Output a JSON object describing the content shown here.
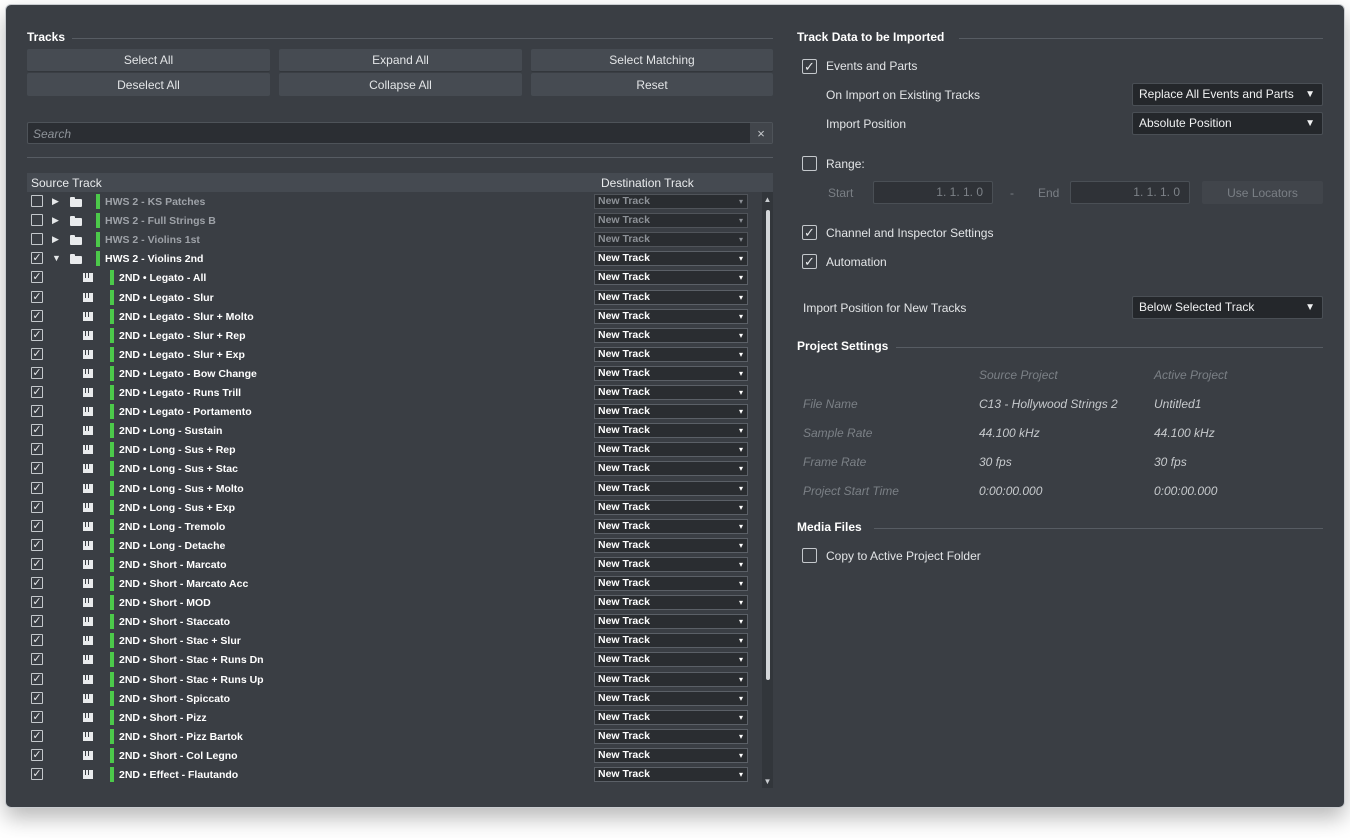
{
  "tracks_panel": {
    "title": "Tracks",
    "buttons": {
      "select_all": "Select All",
      "deselect_all": "Deselect All",
      "expand_all": "Expand All",
      "collapse_all": "Collapse All",
      "select_matching": "Select Matching",
      "reset": "Reset"
    },
    "search_placeholder": "Search",
    "search_clear_icon": "×",
    "columns": {
      "source": "Source Track",
      "destination": "Destination Track"
    },
    "rows": [
      {
        "name": "HWS 2 - KS Patches",
        "dest": "New Track",
        "checked": false,
        "type": "folder",
        "expanded": false,
        "dim": true
      },
      {
        "name": "HWS 2 - Full Strings B",
        "dest": "New Track",
        "checked": false,
        "type": "folder",
        "expanded": false,
        "dim": true
      },
      {
        "name": "HWS 2 - Violins 1st",
        "dest": "New Track",
        "checked": false,
        "type": "folder",
        "expanded": false,
        "dim": true
      },
      {
        "name": "HWS 2 - Violins 2nd",
        "dest": "New Track",
        "checked": true,
        "type": "folder",
        "expanded": true,
        "dim": false
      },
      {
        "name": "2ND • Legato - All",
        "dest": "New Track",
        "checked": true,
        "type": "instrument"
      },
      {
        "name": "2ND • Legato - Slur",
        "dest": "New Track",
        "checked": true,
        "type": "instrument"
      },
      {
        "name": "2ND • Legato - Slur + Molto",
        "dest": "New Track",
        "checked": true,
        "type": "instrument"
      },
      {
        "name": "2ND • Legato - Slur + Rep",
        "dest": "New Track",
        "checked": true,
        "type": "instrument"
      },
      {
        "name": "2ND • Legato - Slur + Exp",
        "dest": "New Track",
        "checked": true,
        "type": "instrument"
      },
      {
        "name": "2ND • Legato - Bow Change",
        "dest": "New Track",
        "checked": true,
        "type": "instrument"
      },
      {
        "name": "2ND • Legato - Runs Trill",
        "dest": "New Track",
        "checked": true,
        "type": "instrument"
      },
      {
        "name": "2ND • Legato - Portamento",
        "dest": "New Track",
        "checked": true,
        "type": "instrument"
      },
      {
        "name": "2ND • Long - Sustain",
        "dest": "New Track",
        "checked": true,
        "type": "instrument"
      },
      {
        "name": "2ND • Long - Sus + Rep",
        "dest": "New Track",
        "checked": true,
        "type": "instrument"
      },
      {
        "name": "2ND • Long - Sus + Stac",
        "dest": "New Track",
        "checked": true,
        "type": "instrument"
      },
      {
        "name": "2ND • Long - Sus + Molto",
        "dest": "New Track",
        "checked": true,
        "type": "instrument"
      },
      {
        "name": "2ND • Long - Sus + Exp",
        "dest": "New Track",
        "checked": true,
        "type": "instrument"
      },
      {
        "name": "2ND • Long - Tremolo",
        "dest": "New Track",
        "checked": true,
        "type": "instrument"
      },
      {
        "name": "2ND • Long - Detache",
        "dest": "New Track",
        "checked": true,
        "type": "instrument"
      },
      {
        "name": "2ND • Short - Marcato",
        "dest": "New Track",
        "checked": true,
        "type": "instrument"
      },
      {
        "name": "2ND • Short - Marcato Acc",
        "dest": "New Track",
        "checked": true,
        "type": "instrument"
      },
      {
        "name": "2ND • Short - MOD",
        "dest": "New Track",
        "checked": true,
        "type": "instrument"
      },
      {
        "name": "2ND • Short - Staccato",
        "dest": "New Track",
        "checked": true,
        "type": "instrument"
      },
      {
        "name": "2ND • Short - Stac + Slur",
        "dest": "New Track",
        "checked": true,
        "type": "instrument"
      },
      {
        "name": "2ND • Short - Stac + Runs Dn",
        "dest": "New Track",
        "checked": true,
        "type": "instrument"
      },
      {
        "name": "2ND • Short - Stac + Runs Up",
        "dest": "New Track",
        "checked": true,
        "type": "instrument"
      },
      {
        "name": "2ND • Short - Spiccato",
        "dest": "New Track",
        "checked": true,
        "type": "instrument"
      },
      {
        "name": "2ND • Short - Pizz",
        "dest": "New Track",
        "checked": true,
        "type": "instrument"
      },
      {
        "name": "2ND • Short - Pizz Bartok",
        "dest": "New Track",
        "checked": true,
        "type": "instrument"
      },
      {
        "name": "2ND • Short - Col Legno",
        "dest": "New Track",
        "checked": true,
        "type": "instrument"
      },
      {
        "name": "2ND • Effect - Flautando",
        "dest": "New Track",
        "checked": true,
        "type": "instrument"
      }
    ]
  },
  "track_data": {
    "title": "Track Data to be Imported",
    "events_and_parts": {
      "label": "Events and Parts",
      "checked": true
    },
    "on_import_label": "On Import on Existing Tracks",
    "on_import_value": "Replace All Events and Parts",
    "import_position_label": "Import Position",
    "import_position_value": "Absolute Position",
    "range": {
      "label": "Range:",
      "checked": false,
      "start_label": "Start",
      "start_value": "1. 1. 1.  0",
      "separator": "-",
      "end_label": "End",
      "end_value": "1. 1. 1.  0",
      "use_locators": "Use Locators"
    },
    "channel_settings": {
      "label": "Channel and Inspector Settings",
      "checked": true
    },
    "automation": {
      "label": "Automation",
      "checked": true
    },
    "new_tracks_label": "Import Position for New Tracks",
    "new_tracks_value": "Below Selected Track"
  },
  "project_settings": {
    "title": "Project Settings",
    "col_source": "Source Project",
    "col_active": "Active Project",
    "rows": [
      {
        "key": "File Name",
        "source": "C13 - Hollywood Strings 2",
        "active": "Untitled1"
      },
      {
        "key": "Sample Rate",
        "source": "44.100 kHz",
        "active": "44.100 kHz"
      },
      {
        "key": "Frame Rate",
        "source": "30 fps",
        "active": "30 fps"
      },
      {
        "key": "Project Start Time",
        "source": "0:00:00.000",
        "active": "0:00:00.000"
      }
    ]
  },
  "media_files": {
    "title": "Media Files",
    "copy_label": "Copy to Active Project Folder",
    "copy_checked": false
  },
  "glyphs": {
    "check": "✓",
    "dropdown_arrow": "▼",
    "small_arrow": "▾",
    "tri_collapsed": "▶",
    "tri_expanded": "▼",
    "scroll_up": "▲",
    "scroll_down": "▼"
  }
}
